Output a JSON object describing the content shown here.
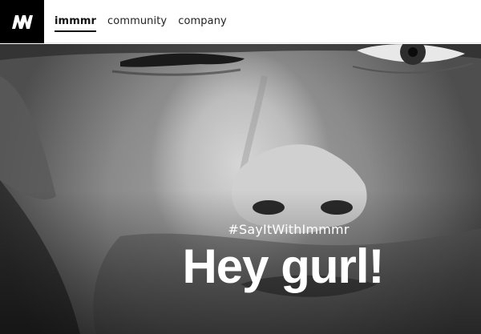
{
  "brand": {
    "logo_glyph": "m",
    "logo_bg": "#000000"
  },
  "nav": {
    "items": [
      {
        "label": "immmr",
        "active": true
      },
      {
        "label": "community",
        "active": false
      },
      {
        "label": "company",
        "active": false
      }
    ]
  },
  "hero": {
    "hashtag": "#SayItWithImmmr",
    "headline": "Hey gurl!",
    "image_style": "grayscale portrait close-up"
  }
}
